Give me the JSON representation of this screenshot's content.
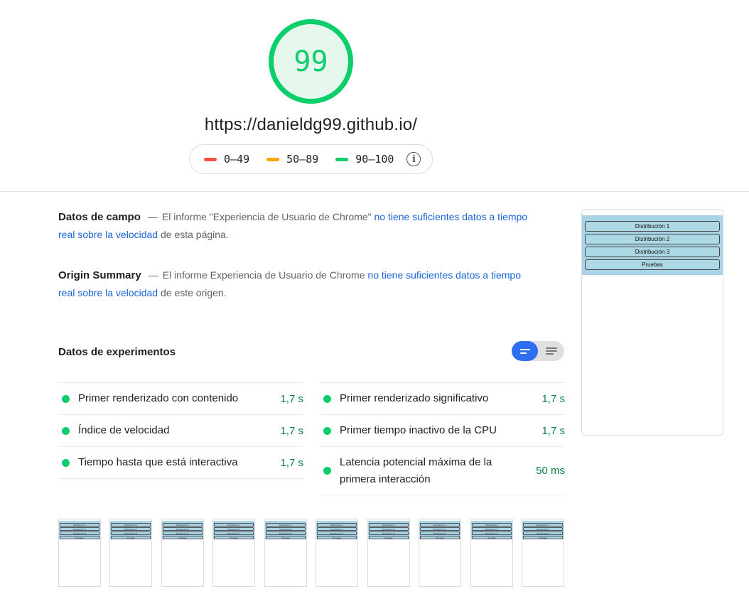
{
  "score": "99",
  "url": "https://danieldg99.github.io/",
  "legend": [
    {
      "range": "0–49",
      "color": "#ff4e42"
    },
    {
      "range": "50–89",
      "color": "#ffa400"
    },
    {
      "range": "90–100",
      "color": "#0cce6b"
    }
  ],
  "field_data": {
    "title": "Datos de campo",
    "text_before": "El informe \"Experiencia de Usuario de Chrome\" ",
    "link": "no tiene suficientes datos a tiempo real sobre la velocidad",
    "text_after": " de esta página."
  },
  "origin_summary": {
    "title": "Origin Summary",
    "text_before": "El informe Experiencia de Usuario de Chrome ",
    "link": "no tiene suficientes datos a tiempo real sobre la velocidad",
    "text_after": " de este origen."
  },
  "lab_data": {
    "title": "Datos de experimentos"
  },
  "metrics_left": [
    {
      "label": "Primer renderizado con contenido",
      "value": "1,7 s"
    },
    {
      "label": "Índice de velocidad",
      "value": "1,7 s"
    },
    {
      "label": "Tiempo hasta que está interactiva",
      "value": "1,7 s"
    }
  ],
  "metrics_right": [
    {
      "label": "Primer renderizado significativo",
      "value": "1,7 s"
    },
    {
      "label": "Primer tiempo inactivo de la CPU",
      "value": "1,7 s"
    },
    {
      "label": "Latencia potencial máxima de la primera interacción",
      "value": "50 ms"
    }
  ],
  "preview_buttons": [
    "Distribución 1",
    "Distribución 2",
    "Distribución 3",
    "Pruebas"
  ],
  "colors": {
    "pass": "#0cce6b",
    "link": "#1a64d8",
    "toggle_active": "#2f6ef1"
  }
}
